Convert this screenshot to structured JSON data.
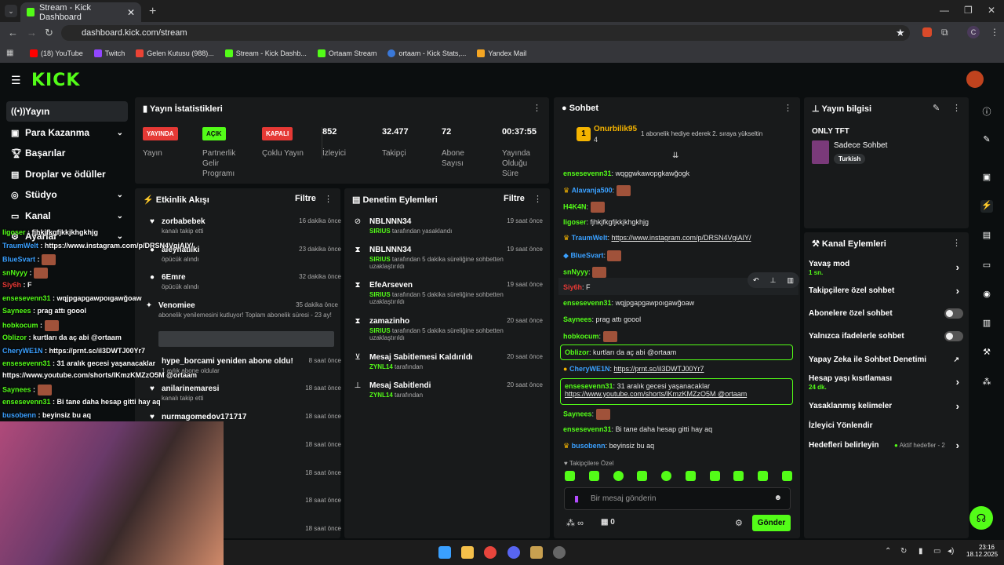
{
  "browser": {
    "tab_title": "Stream - Kick Dashboard",
    "url": "dashboard.kick.com/stream",
    "bookmarks": [
      "(18) YouTube",
      "Twitch",
      "Gelen Kutusu (988)...",
      "Stream - Kick Dashb...",
      "Ortaam Stream",
      "ortaam - Kick Stats,...",
      "Yandex Mail"
    ],
    "profile_initial": "C"
  },
  "brand": {
    "logo": "KICK",
    "accent": "#53fc18"
  },
  "sidebar": {
    "items": [
      {
        "label": "Yayın",
        "icon": "broadcast-icon"
      },
      {
        "label": "Para Kazanma",
        "icon": "money-icon"
      },
      {
        "label": "Başarılar",
        "icon": "trophy-icon"
      },
      {
        "label": "Droplar ve ödüller",
        "icon": "gift-icon"
      },
      {
        "label": "Stüdyo",
        "icon": "studio-icon"
      },
      {
        "label": "Kanal",
        "icon": "channel-icon"
      },
      {
        "label": "Ayarlar",
        "icon": "gear-icon"
      }
    ]
  },
  "stats": {
    "title": "Yayın İstatistikleri",
    "items": [
      {
        "badge": "YAYINDA",
        "label": "Yayın",
        "badge_color": "#e53935"
      },
      {
        "badge": "AÇIK",
        "label": "Partnerlik Gelir Programı",
        "badge_color": "#53fc18"
      },
      {
        "badge": "KAPALI",
        "label": "Çoklu Yayın",
        "badge_color": "#e53935"
      },
      {
        "value": "852",
        "label": "İzleyici"
      },
      {
        "value": "32.477",
        "label": "Takipçi"
      },
      {
        "value": "72",
        "label": "Abone Sayısı"
      },
      {
        "value": "00:37:55",
        "label": "Yayında Olduğu Süre"
      }
    ]
  },
  "activity": {
    "title": "Etkinlik Akışı",
    "filter": "Filtre",
    "events": [
      {
        "name": "zorbabebek",
        "sub": "kanalı takip etti",
        "time": "16 dakika önce"
      },
      {
        "name": "aleynatilki",
        "sub": "öpücük alındı",
        "time": "23 dakika önce"
      },
      {
        "name": "6Emre",
        "sub": "öpücük alındı",
        "time": "32 dakika önce"
      },
      {
        "name": "Venomiee",
        "sub": "abonelik yenilemesini kutluyor! Toplam abonelik süresi - 23 ay!",
        "time": "35 dakika önce"
      },
      {
        "name": "hype_borcami yeniden abone oldu!",
        "sub": "1 aylık abone oldular",
        "time": "8 saat önce"
      },
      {
        "name": "anilarinemaresi",
        "sub": "kanalı takip etti",
        "time": "18 saat önce"
      },
      {
        "name": "nurmagomedov171717",
        "sub": "",
        "time": "18 saat önce"
      },
      {
        "name": "",
        "sub": "",
        "time": "18 saat önce"
      },
      {
        "name": "",
        "sub": "",
        "time": "18 saat önce"
      },
      {
        "name": "",
        "sub": "",
        "time": "18 saat önce"
      },
      {
        "name": "",
        "sub": "",
        "time": "18 saat önce"
      }
    ]
  },
  "moderation": {
    "title": "Denetim Eylemleri",
    "filter": "Filtre",
    "actions": [
      {
        "name": "NBLNNN34",
        "by": "SIRIUS",
        "sub": "tarafından yasaklandı",
        "time": "19 saat önce"
      },
      {
        "name": "NBLNNN34",
        "by": "SIRIUS",
        "sub": "tarafından 5 dakika süreliğine sohbetten uzaklaştırıldı",
        "time": "19 saat önce"
      },
      {
        "name": "EfeArseven",
        "by": "SIRIUS",
        "sub": "tarafından 5 dakika süreliğine sohbetten uzaklaştırıldı",
        "time": "19 saat önce"
      },
      {
        "name": "zamazinho",
        "by": "SIRIUS",
        "sub": "tarafından 5 dakika süreliğine sohbetten uzaklaştırıldı",
        "time": "20 saat önce"
      },
      {
        "name": "Mesaj Sabitlemesi Kaldırıldı",
        "by": "ZYNL14",
        "sub": "tarafından",
        "time": "20 saat önce"
      },
      {
        "name": "Mesaj Sabitlendi",
        "by": "ZYNL14",
        "sub": "tarafından",
        "time": "20 saat önce"
      }
    ]
  },
  "chat": {
    "title": "Sohbet",
    "top_user": "Onurbilik95",
    "top_count": "4",
    "top_note": "1 abonelik hediye ederek 2. sıraya yükseltin",
    "messages": [
      {
        "user": "ensesevenn31",
        "color": "#53fc18",
        "text": "wqggwkawopgkawğogk"
      },
      {
        "user": "Alavanja500",
        "color": "#3aa0ff",
        "text": ""
      },
      {
        "user": "H4K4N",
        "color": "#53fc18",
        "text": ""
      },
      {
        "user": "ligoser",
        "color": "#53fc18",
        "text": "fjhkjfkgfjkkjkhgkhjg"
      },
      {
        "user": "TraumWelt",
        "color": "#3aa0ff",
        "text": "https://www.instagram.com/p/DRSN4VgiAIY/"
      },
      {
        "user": "BlueSvart",
        "color": "#3aa0ff",
        "text": ""
      },
      {
        "user": "snNyyy",
        "color": "#53fc18",
        "text": ""
      },
      {
        "user": "Siy6h",
        "color": "#e53935",
        "text": "F"
      },
      {
        "user": "ensesevenn31",
        "color": "#53fc18",
        "text": "wqjpgapgawpoıgawğoaw"
      },
      {
        "user": "Saynees",
        "color": "#53fc18",
        "text": "prag attı goool"
      },
      {
        "user": "hobkocum",
        "color": "#53fc18",
        "text": ""
      },
      {
        "user": "Oblizor",
        "color": "#53fc18",
        "text": "kurtları da aç abi @ortaam"
      },
      {
        "user": "CheryWE1N",
        "color": "#3aa0ff",
        "text": "https://prnt.sc/iI3DWTJ00Yr7"
      },
      {
        "user": "ensesevenn31",
        "color": "#53fc18",
        "text": "31 aralık gecesi yaşanacaklar"
      },
      {
        "user": "",
        "color": "#fff",
        "text": "https://www.youtube.com/shorts/lKmzKMZzO5M @ortaam"
      },
      {
        "user": "Saynees",
        "color": "#53fc18",
        "text": ""
      },
      {
        "user": "ensesevenn31",
        "color": "#53fc18",
        "text": "Bi tane daha hesap gitti hay aq"
      },
      {
        "user": "busobenn",
        "color": "#3aa0ff",
        "text": "beyinsiz bu aq"
      }
    ],
    "followers_only": "Takipçilere Özel",
    "input_placeholder": "Bir mesaj gönderin",
    "infinity_label": "∞",
    "points": "0",
    "send": "Gönder"
  },
  "stream_info": {
    "title": "Yayın bilgisi",
    "stream_title": "ONLY TFT",
    "category": "Sadece Sohbet",
    "tag": "Turkish"
  },
  "channel_actions": {
    "title": "Kanal Eylemleri",
    "items": [
      {
        "label": "Yavaş mod",
        "sub": "1 sn."
      },
      {
        "label": "Takipçilere özel sohbet",
        "sub": ""
      },
      {
        "label": "Abonelere özel sohbet",
        "sub": ""
      },
      {
        "label": "Yalnızca ifadelerle sohbet",
        "sub": ""
      },
      {
        "label": "Yapay Zeka ile Sohbet Denetimi",
        "sub": ""
      },
      {
        "label": "Hesap yaşı kısıtlaması",
        "sub": "24 dk."
      },
      {
        "label": "Yasaklanmış kelimeler",
        "sub": ""
      },
      {
        "label": "İzleyici Yönlendir",
        "sub": ""
      },
      {
        "label": "Hedefleri belirleyin",
        "sub": ""
      }
    ],
    "goals_note": "Aktif hedefler - 2"
  },
  "overlay_chat": [
    {
      "user": "ligoser",
      "text": "fjhkjfkgfjkkjkhgkhjg"
    },
    {
      "user": "TraumWelt",
      "text": "https://www.instagram.com/p/DRSN4VgiAIY/"
    },
    {
      "user": "BlueSvart",
      "text": ""
    },
    {
      "user": "snNyyy",
      "text": ""
    },
    {
      "user": "Siy6h",
      "text": "F"
    },
    {
      "user": "ensesevenn31",
      "text": "wqjpgapgawpoıgawğoaw"
    },
    {
      "user": "Saynees",
      "text": "prag attı goool"
    },
    {
      "user": "hobkocum",
      "text": ""
    },
    {
      "user": "Oblizor",
      "text": "kurtları da aç abi @ortaam"
    },
    {
      "user": "CheryWE1N",
      "text": "https://prnt.sc/iI3DWTJ00Yr7"
    },
    {
      "user": "ensesevenn31",
      "text": "31 aralık gecesi yaşanacaklar"
    },
    {
      "user": "",
      "text": "https://www.youtube.com/shorts/lKmzKMZzO5M @ortaam"
    },
    {
      "user": "Saynees",
      "text": ""
    },
    {
      "user": "ensesevenn31",
      "text": "Bi tane daha hesap gitti hay aq"
    },
    {
      "user": "busobenn",
      "text": "beyinsiz bu aq"
    }
  ],
  "taskbar": {
    "time": "23:16",
    "date": "18.12.2025"
  }
}
